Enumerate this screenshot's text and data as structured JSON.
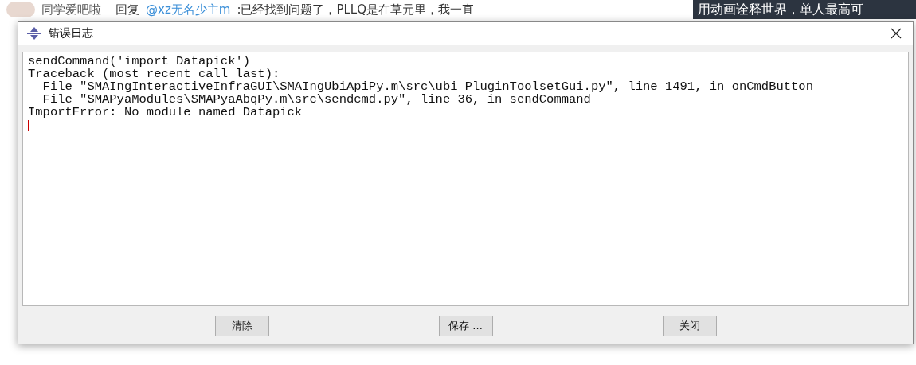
{
  "background": {
    "comment": {
      "author": "同学爱吧啦",
      "reply_prefix": "回复",
      "mention": "@xz无名少主m",
      "text": ":已经找到问题了，PLLQ是在草元里，我一直"
    },
    "banner": {
      "text": "用动画诠释世界，单人最高可"
    }
  },
  "dialog": {
    "title": "错误日志",
    "log_lines": [
      "sendCommand('import Datapick')",
      "Traceback (most recent call last):",
      "  File \"SMAIngInteractiveInfraGUI\\SMAIngUbiApiPy.m\\src\\ubi_PluginToolsetGui.py\", line 1491, in onCmdButton",
      "  File \"SMAPyaModules\\SMAPyaAbqPy.m\\src\\sendcmd.py\", line 36, in sendCommand",
      "ImportError: No module named Datapick"
    ],
    "buttons": [
      "清除",
      "保存 ...",
      "关闭"
    ]
  }
}
